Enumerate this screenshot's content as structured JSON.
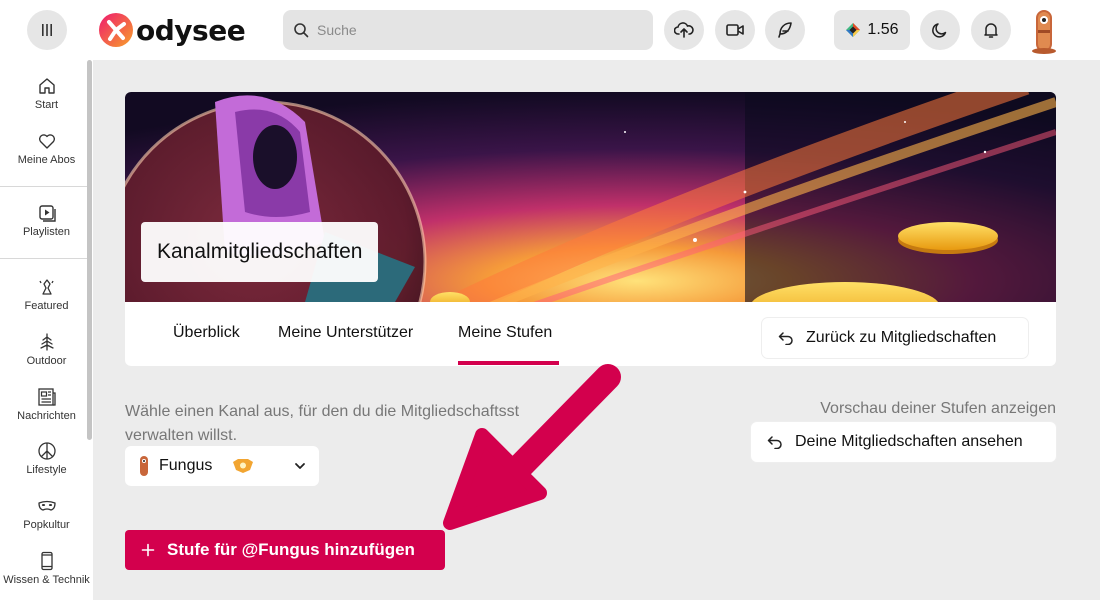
{
  "header": {
    "logo_text": "odysee",
    "search_placeholder": "Suche",
    "credits": "1.56",
    "icons": [
      "menu-icon",
      "upload-icon",
      "video-camera-icon",
      "feather-icon",
      "moon-icon",
      "bell-icon"
    ]
  },
  "sidebar": {
    "items": [
      {
        "label": "Start",
        "icon": "home-icon"
      },
      {
        "label": "Meine Abos",
        "icon": "heart-icon"
      },
      {
        "label": "Playlisten",
        "icon": "playlist-icon"
      },
      {
        "label": "Featured",
        "icon": "featured-icon"
      },
      {
        "label": "Outdoor",
        "icon": "tree-icon"
      },
      {
        "label": "Nachrichten",
        "icon": "newspaper-icon"
      },
      {
        "label": "Lifestyle",
        "icon": "peace-icon"
      },
      {
        "label": "Popkultur",
        "icon": "mask-icon"
      },
      {
        "label": "Wissen & Technik",
        "icon": "phone-icon"
      }
    ]
  },
  "page": {
    "title": "Kanalmitgliedschaften",
    "tabs": [
      {
        "label": "Überblick",
        "active": false
      },
      {
        "label": "Meine Unterstützer",
        "active": false
      },
      {
        "label": "Meine Stufen",
        "active": true
      }
    ],
    "back_button": "Zurück zu Mitgliedschaften",
    "description": "Wähle einen Kanal aus, für den du die Mitgliedschaftsst",
    "description_line2": "verwalten willst.",
    "preview_label": "Vorschau deiner Stufen anzeigen",
    "view_memberships_button": "Deine Mitgliedschaften ansehen",
    "channel_select": "Fungus",
    "add_tier_button": "Stufe für @Fungus hinzufügen"
  },
  "colors": {
    "accent": "#d3004d",
    "background": "#ececec"
  }
}
